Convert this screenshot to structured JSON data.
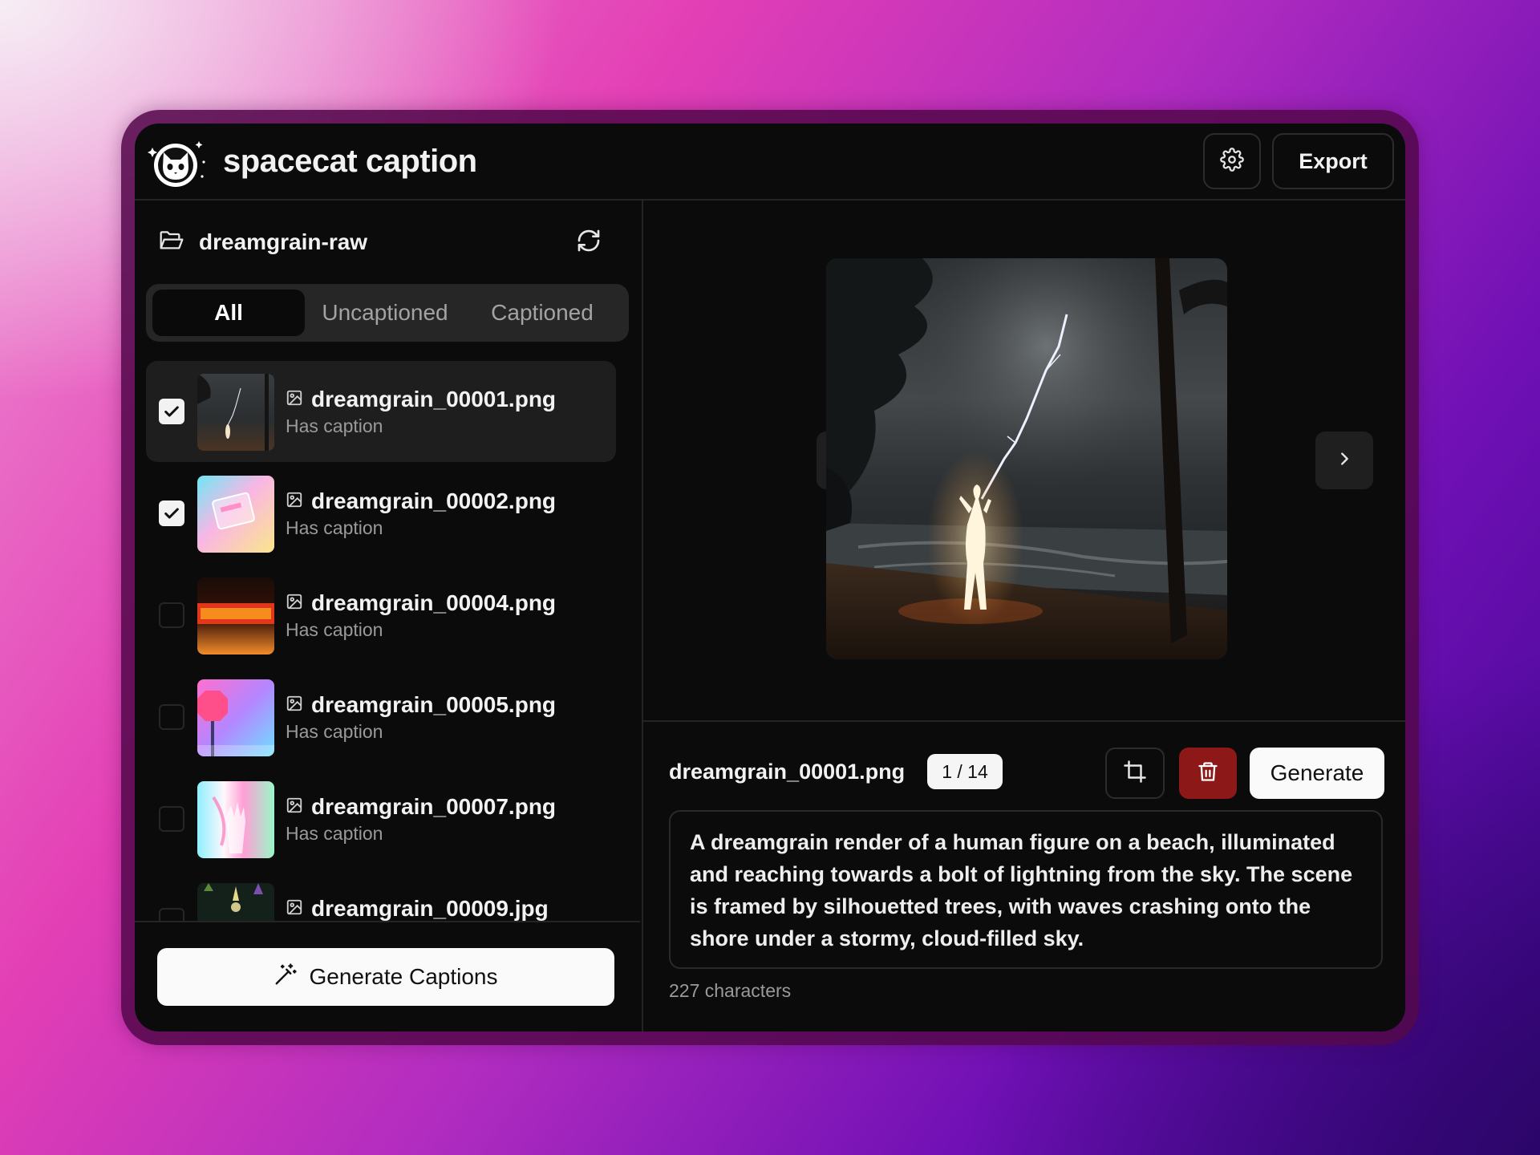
{
  "app": {
    "title": "spacecat caption"
  },
  "header": {
    "settings_icon": "gear-icon",
    "export_label": "Export"
  },
  "sidebar": {
    "folder_icon": "folder-open-icon",
    "folder_name": "dreamgrain-raw",
    "refresh_icon": "refresh-icon",
    "tabs": [
      {
        "label": "All",
        "active": true
      },
      {
        "label": "Uncaptioned",
        "active": false
      },
      {
        "label": "Captioned",
        "active": false
      }
    ],
    "files": [
      {
        "name": "dreamgrain_00001.png",
        "status": "Has caption",
        "checked": true,
        "selected": true,
        "thumb": "lightning-beach"
      },
      {
        "name": "dreamgrain_00002.png",
        "status": "Has caption",
        "checked": true,
        "selected": false,
        "thumb": "pastel-card"
      },
      {
        "name": "dreamgrain_00004.png",
        "status": "Has caption",
        "checked": false,
        "selected": false,
        "thumb": "neon-sign"
      },
      {
        "name": "dreamgrain_00005.png",
        "status": "Has caption",
        "checked": false,
        "selected": false,
        "thumb": "stop-sign"
      },
      {
        "name": "dreamgrain_00007.png",
        "status": "Has caption",
        "checked": false,
        "selected": false,
        "thumb": "holo-hand"
      },
      {
        "name": "dreamgrain_00009.jpg",
        "status": "",
        "checked": false,
        "selected": false,
        "thumb": "dark-forest"
      }
    ],
    "generate_captions_label": "Generate Captions",
    "generate_captions_icon": "magic-wand-icon"
  },
  "viewer": {
    "prev_icon": "chevron-left-icon",
    "next_icon": "chevron-right-icon"
  },
  "editor": {
    "current_file": "dreamgrain_00001.png",
    "counter": "1 / 14",
    "crop_icon": "crop-icon",
    "delete_icon": "trash-icon",
    "generate_label": "Generate",
    "caption": "A dreamgrain render of a human figure on a beach, illuminated and reaching towards a bolt of lightning from the sky. The scene is framed by silhouetted trees, with waves crashing onto the shore under a stormy, cloud-filled sky.",
    "char_count": "227 characters"
  },
  "colors": {
    "window_bg": "#0b0b0b",
    "delete_red": "#8d1818",
    "panel_border": "#242424"
  }
}
